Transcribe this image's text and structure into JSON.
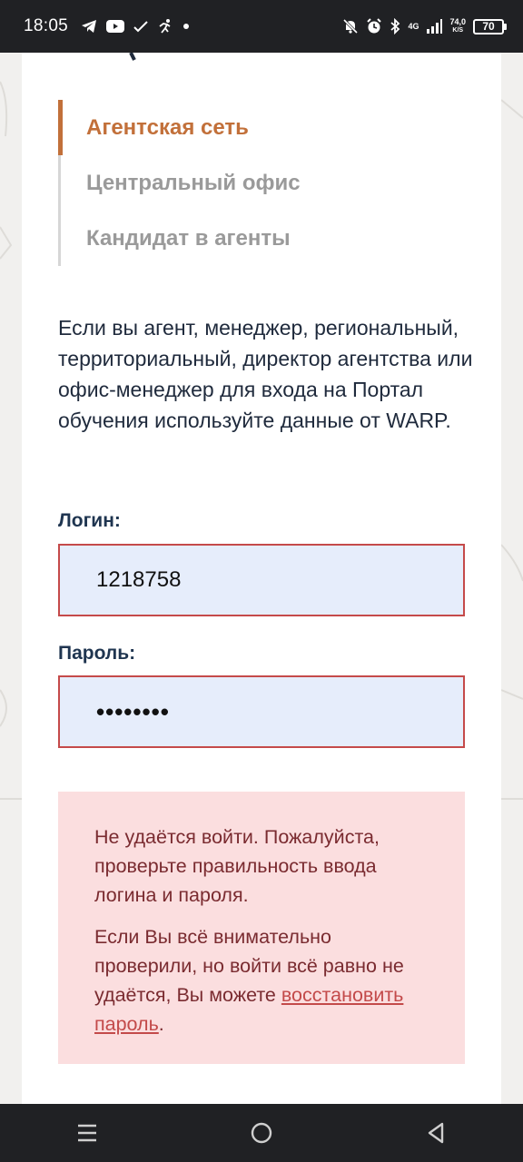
{
  "status_bar": {
    "time": "18:05",
    "left_icons": [
      "telegram-icon",
      "youtube-icon",
      "check-icon",
      "fitness-icon",
      "dot-icon"
    ],
    "right_icons": [
      "mute-icon",
      "alarm-icon",
      "bluetooth-icon",
      "signal-icon"
    ],
    "network_type": "4G",
    "speed_value": "74,0",
    "speed_unit": "K/S",
    "battery": "70"
  },
  "tabs": [
    {
      "label": "Агентская сеть",
      "active": true
    },
    {
      "label": "Центральный офис",
      "active": false
    },
    {
      "label": "Кандидат в агенты",
      "active": false
    }
  ],
  "info_text": "Если вы агент, менеджер, региональный, территориальный, директор агентства или офис-менеджер для входа на Портал обучения используйте данные от WARP.",
  "login": {
    "label": "Логин:",
    "value": "1218758"
  },
  "password": {
    "label": "Пароль:",
    "value": "••••••••"
  },
  "error": {
    "message": "Не удаётся войти. Пожалуйста, проверьте правильность ввода логина и пароля.",
    "help_prefix": "Если Вы всё внимательно проверили, но войти всё равно не удаётся, Вы можете ",
    "help_link": "восстановить пароль",
    "help_suffix": "."
  },
  "colors": {
    "accent": "#c2703a",
    "error_bg": "#fbdedf",
    "error_text": "#7a2b30",
    "field_bg": "#e6edfb",
    "field_border": "#c54a4a"
  },
  "nav": [
    "recents-icon",
    "home-icon",
    "back-icon"
  ]
}
